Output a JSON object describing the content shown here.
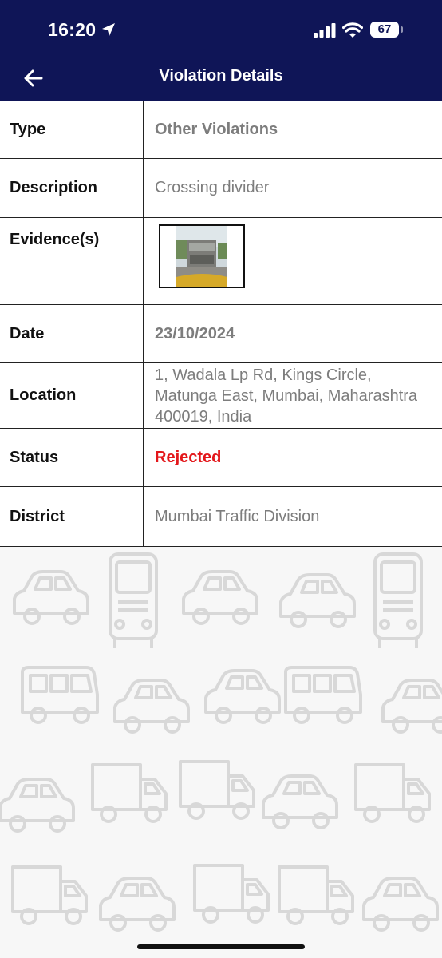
{
  "status_bar": {
    "time": "16:20",
    "battery": "67"
  },
  "header": {
    "title": "Violation Details"
  },
  "details": {
    "type": {
      "label": "Type",
      "value": "Other Violations"
    },
    "description": {
      "label": "Description",
      "value": "Crossing divider"
    },
    "evidence": {
      "label": "Evidence(s)"
    },
    "date": {
      "label": "Date",
      "value": "23/10/2024"
    },
    "location": {
      "label": "Location",
      "value": "1, Wadala Lp Rd, Kings Circle, Matunga East, Mumbai, Maharashtra 400019, India"
    },
    "status": {
      "label": "Status",
      "value": "Rejected"
    },
    "district": {
      "label": "District",
      "value": "Mumbai Traffic Division"
    }
  },
  "colors": {
    "header_bg": "#0f1557",
    "status_rejected": "#e3161a",
    "value_text": "#7d7d7d"
  },
  "icons": {
    "back": "arrow-left-icon",
    "location_services": "location-arrow-icon",
    "signal": "cellular-signal-icon",
    "wifi": "wifi-icon",
    "battery": "battery-icon",
    "background": "vehicle-pattern"
  }
}
